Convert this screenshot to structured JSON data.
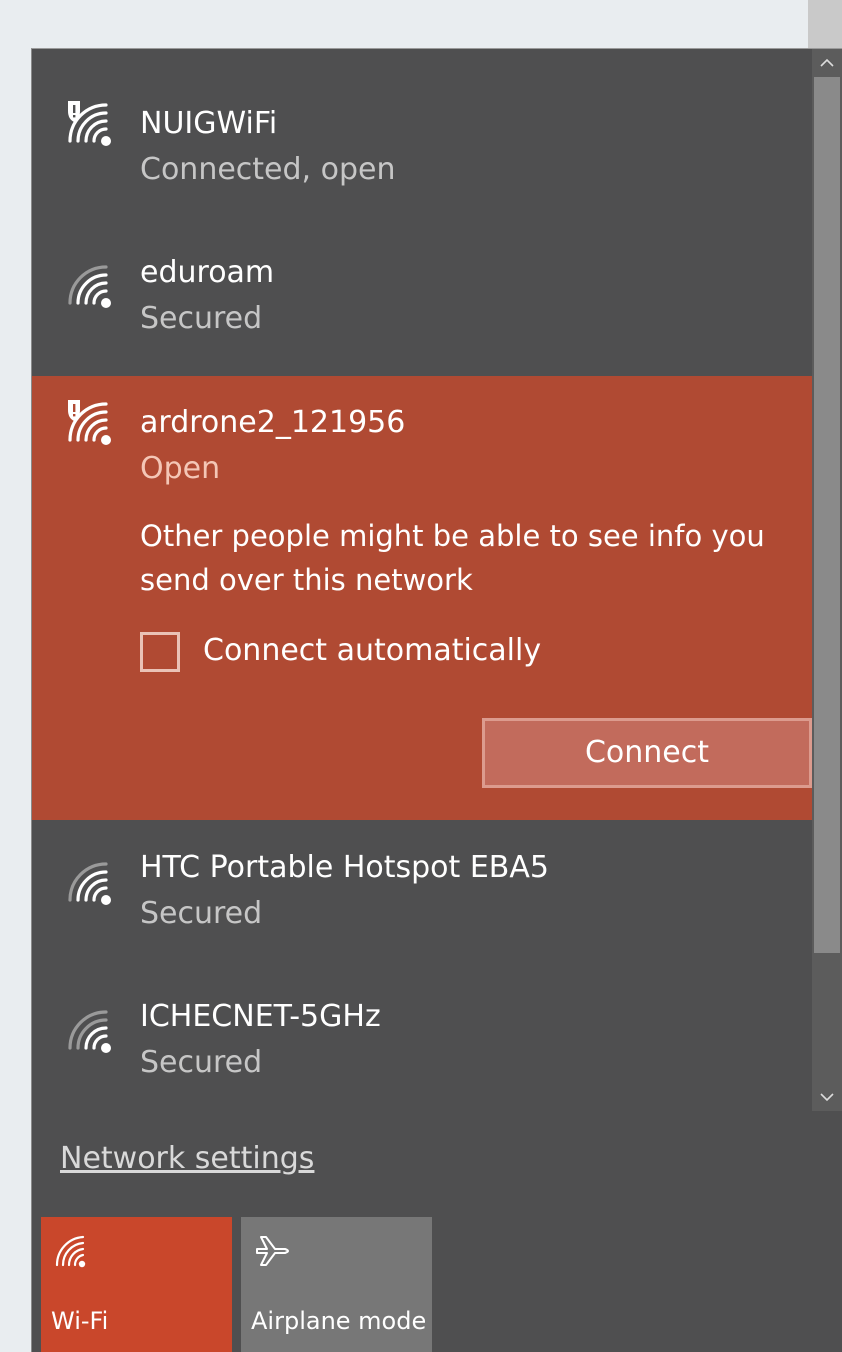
{
  "networks": [
    {
      "name": "NUIGWiFi",
      "status": "Connected, open",
      "icon": "wifi-warning-icon"
    },
    {
      "name": "eduroam",
      "status": "Secured",
      "icon": "wifi-icon"
    },
    {
      "name": "ardrone2_121956",
      "status": "Open",
      "icon": "wifi-warning-icon",
      "warning": "Other people might be able to see info you send over this network",
      "auto_connect_label": "Connect automatically",
      "auto_connect_checked": false,
      "connect_label": "Connect"
    },
    {
      "name": "HTC Portable Hotspot EBA5",
      "status": "Secured",
      "icon": "wifi-icon"
    },
    {
      "name": "ICHECNET-5GHz",
      "status": "Secured",
      "icon": "wifi-icon"
    }
  ],
  "scroll": {
    "up": "^",
    "down": "v"
  },
  "settings_link": "Network settings",
  "quick_actions": [
    {
      "label": "Wi-Fi",
      "icon": "wifi-icon",
      "state": "on",
      "color": "#c9472b"
    },
    {
      "label": "Airplane mode",
      "icon": "airplane-icon",
      "state": "off",
      "color": "#777777"
    }
  ],
  "colors": {
    "accent": "#b04a33",
    "panel": "#4f4f50"
  }
}
